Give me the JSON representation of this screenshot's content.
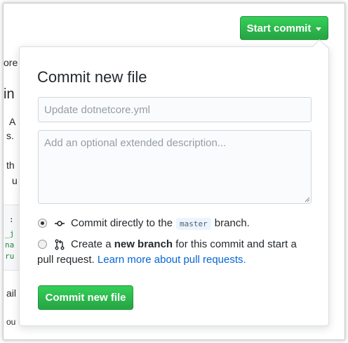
{
  "header": {
    "start_commit_label": "Start commit"
  },
  "background": {
    "fragments": [
      "ore",
      "in",
      "A",
      "s.",
      "th",
      "u",
      ":",
      "_j",
      "na",
      "ru",
      "ail",
      "ou"
    ]
  },
  "dialog": {
    "title": "Commit new file",
    "summary_placeholder": "Update dotnetcore.yml",
    "description_placeholder": "Add an optional extended description...",
    "option_direct": {
      "prefix": "Commit directly to the",
      "branch": "master",
      "suffix": "branch.",
      "selected": true
    },
    "option_new_branch": {
      "prefix": "Create a",
      "bold": "new branch",
      "middle": "for this commit and start a",
      "line2": "pull request.",
      "link": "Learn more about pull requests.",
      "selected": false
    },
    "submit_label": "Commit new file"
  },
  "colors": {
    "primary_green": "#28a745",
    "link_blue": "#0366d6",
    "branch_bg": "#eaf5ff"
  },
  "icons": {
    "direct": "git-commit-icon",
    "new_branch": "git-pull-request-icon",
    "caret": "caret-down-icon"
  }
}
